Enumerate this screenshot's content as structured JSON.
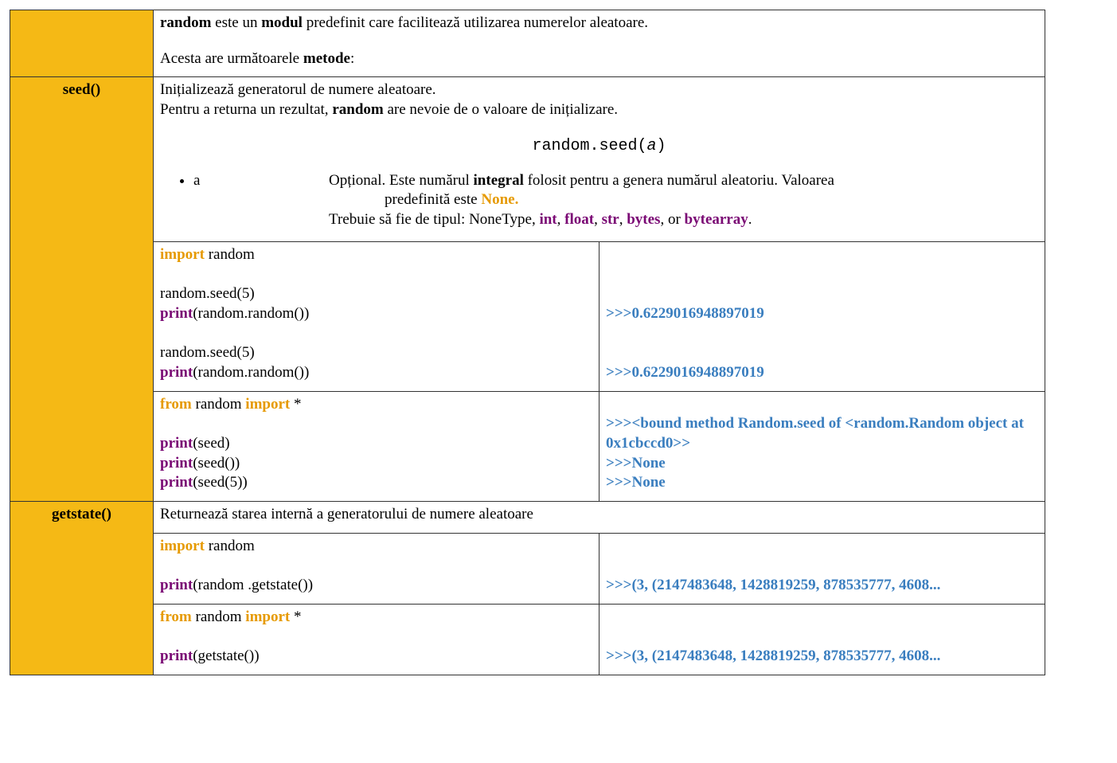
{
  "intro": {
    "w1": "random",
    "t1": " este un ",
    "w2": "modul",
    "t2": " predefinit care facilitează utilizarea numerelor aleatoare.",
    "line2a": "Acesta are următoarele ",
    "w3": "metode",
    "line2b": ":"
  },
  "seed": {
    "name": "seed()",
    "desc1": "Inițializează generatorul de numere aleatoare.",
    "desc2a": "Pentru a returna un rezultat, ",
    "desc2b": "random",
    "desc2c": " are nevoie de o valoare de inițializare.",
    "sig_pre": "random.seed(",
    "sig_arg": "a",
    "sig_post": ")",
    "param_name": "a",
    "param_l1a": "Opțional. Este numărul ",
    "param_l1b": "integral",
    "param_l1c": " folosit pentru a genera numărul aleatoriu. Valoarea",
    "param_l2a": "predefinită este ",
    "param_l2b": "None.",
    "types_pre": "Trebuie să fie de tipul: NoneType, ",
    "t_int": "int",
    "t_float": "float",
    "t_str": "str",
    "t_bytes": "bytes",
    "t_or": ", or ",
    "t_bytearray": "bytearray",
    "t_dot": ".",
    "comma": ", ",
    "code1": {
      "import": "import",
      "random": " random",
      "seed_call": "random.seed(5)",
      "print": "print",
      "print_arg": "(random.random())"
    },
    "out1": {
      "p": ">>>",
      "v": "0.6229016948897019"
    },
    "code2": {
      "from": "from",
      "random": " random ",
      "import": "import",
      "star": " *",
      "print": "print",
      "a1": "(seed)",
      "a2": "(seed())",
      "a3": "(seed(5))"
    },
    "out2": {
      "p": ">>>",
      "v1": "<bound method Random.seed of <random.Random object at 0x1cbccd0>>",
      "v2": "None",
      "v3": "None"
    }
  },
  "getstate": {
    "name": "getstate()",
    "desc": "Returnează starea internă a generatorului de numere aleatoare",
    "code1": {
      "import": "import",
      "random": " random",
      "print": "print",
      "arg": "(random .getstate())"
    },
    "out": {
      "p": ">>>",
      "v": "(3, (2147483648, 1428819259, 878535777, 4608..."
    },
    "code2": {
      "from": "from",
      "random": " random ",
      "import": "import",
      "star": " *",
      "print": "print",
      "arg": "(getstate())"
    }
  }
}
